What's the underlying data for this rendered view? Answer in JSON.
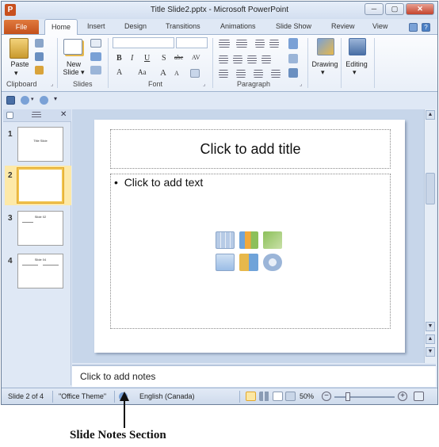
{
  "window": {
    "title": "Title Slide2.pptx - Microsoft PowerPoint",
    "app_icon_letter": "P",
    "minimize_glyph": "─",
    "restore_glyph": "▢",
    "close_glyph": "✕"
  },
  "tabs": {
    "file": "File",
    "items": [
      "Home",
      "Insert",
      "Design",
      "Transitions",
      "Animations",
      "Slide Show",
      "Review",
      "View"
    ],
    "active": "Home",
    "help_glyph": "?"
  },
  "ribbon": {
    "groups": {
      "clipboard": "Clipboard",
      "slides": "Slides",
      "font": "Font",
      "paragraph": "Paragraph"
    },
    "paste_label": "Paste",
    "new_slide_label": [
      "New",
      "Slide ▾"
    ],
    "drawing_label": "Drawing",
    "editing_label": "Editing",
    "font_glyphs": [
      "B",
      "I",
      "U",
      "S",
      "abc",
      "AV",
      "Aa",
      "A",
      "A"
    ],
    "font_size_glyphs": [
      "A",
      "A"
    ]
  },
  "slides_panel": {
    "numbers": [
      "1",
      "2",
      "3",
      "4"
    ],
    "selected": 2,
    "thumb_texts": [
      "Title Slide",
      "",
      "Slide 02",
      "Slide 04"
    ],
    "close_glyph": "✕"
  },
  "slide": {
    "title_placeholder": "Click to add title",
    "body_placeholder": "Click to add text",
    "bullet": "•"
  },
  "notes": {
    "placeholder": "Click to add notes"
  },
  "status": {
    "slide_info": "Slide 2 of 4",
    "theme": "\"Office Theme\"",
    "language": "English (Canada)",
    "zoom": "50%",
    "zoom_level_percent": 50
  },
  "annotation": {
    "label": "Slide Notes Section"
  },
  "colors": {
    "file_tab": "#c4501b",
    "selection": "#f0c34e",
    "ribbon_bg": "#dfe8f5"
  }
}
